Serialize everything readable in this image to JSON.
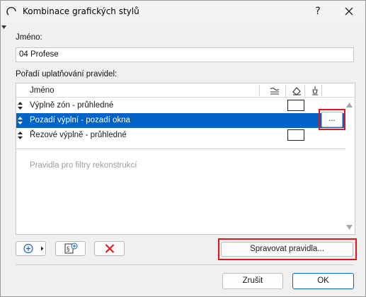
{
  "window": {
    "title": "Kombinace grafických stylů",
    "help_label": "?",
    "title_icon": "refresh-arc-icon",
    "close_icon": "close-icon"
  },
  "name_section": {
    "label": "Jméno:",
    "value": "04 Profese"
  },
  "rules_section": {
    "label": "Pořadí uplatňování pravidel:",
    "column_name": "Jméno",
    "column_icons": [
      "layers-icon",
      "fill-bucket-icon",
      "pen-icon"
    ],
    "rows": [
      {
        "label": "Výplně zón - průhledné",
        "selected": false,
        "swatch": true
      },
      {
        "label": "Pozadí výplní - pozadí okna",
        "selected": true,
        "swatch": false
      },
      {
        "label": "Řezové výplně - průhledné",
        "selected": false,
        "swatch": true
      }
    ],
    "placeholder": "Pravidla pro filtry rekonstrukcí",
    "row_action_label": "...",
    "selection_color": "#0063c7"
  },
  "toolbar": {
    "add_icon": "add-circle-icon",
    "new_rule_icon": "add-rule-icon",
    "delete_icon": "delete-x-icon",
    "manage_label": "Spravovat pravidla..."
  },
  "footer": {
    "cancel_label": "Zrušit",
    "ok_label": "OK"
  },
  "highlight_color": "#e8121b"
}
